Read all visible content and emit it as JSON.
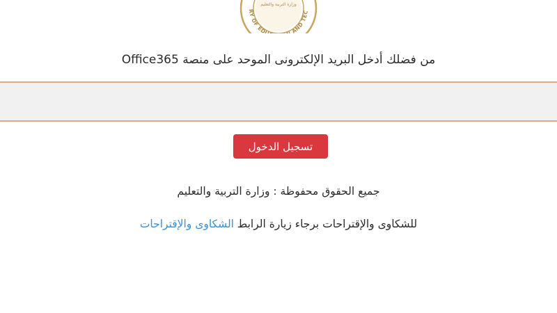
{
  "logo": {
    "seal_text": "MINISTRY OF EDUCATION AND TECHNICAL",
    "seal_center_text": "وزارة التربية والتعليم"
  },
  "login": {
    "prompt": "من فضلك أدخل البريد الإلكترونى الموحد على منصة Office365",
    "email_value": "",
    "submit_label": "تسجيل الدخول"
  },
  "footer": {
    "rights": "جميع الحقوق محفوظة : وزارة التربية والتعليم",
    "complaints_text": "للشكاوى والإقتراحات برجاء زيارة الرابط ",
    "complaints_link": "الشكاوى والإقتراحات"
  },
  "colors": {
    "button_bg": "#d9383f",
    "link": "#3a8fd6",
    "input_border": "#d9aa90",
    "seal_gold": "#c9a55c"
  }
}
